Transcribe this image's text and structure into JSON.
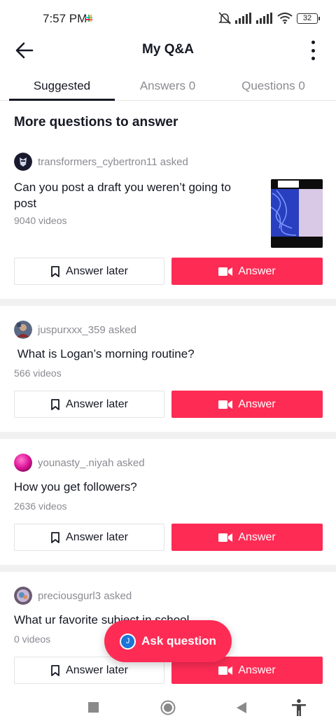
{
  "status_bar": {
    "time": "7:57 PM",
    "battery": "32"
  },
  "header": {
    "title": "My Q&A"
  },
  "tabs": [
    {
      "label": "Suggested",
      "active": true
    },
    {
      "label": "Answers 0",
      "active": false
    },
    {
      "label": "Questions 0",
      "active": false
    }
  ],
  "section": {
    "heading": "More questions to answer"
  },
  "questions": [
    {
      "asker": "transformers_cybertron11 asked",
      "question_line1": "Can you post a draft you weren’t going to",
      "question_line2": "post",
      "videos": "9040 videos"
    },
    {
      "asker": "juspurxxx_359 asked",
      "question_line1": " What is Logan’s morning routine?",
      "videos": "566 videos"
    },
    {
      "asker": "younasty_.niyah asked",
      "question_line1": "How you get followers?",
      "videos": "2636 videos"
    },
    {
      "asker": "preciousgurl3 asked",
      "question_line1": "What ur favorite subject in school",
      "videos": "0 videos"
    }
  ],
  "buttons": {
    "answer_later": "Answer later",
    "answer": "Answer"
  },
  "fab": {
    "label": "Ask question",
    "avatar_initial": "J"
  },
  "colors": {
    "accent": "#fe2c55",
    "text": "#161823",
    "muted": "#8a8b91"
  }
}
